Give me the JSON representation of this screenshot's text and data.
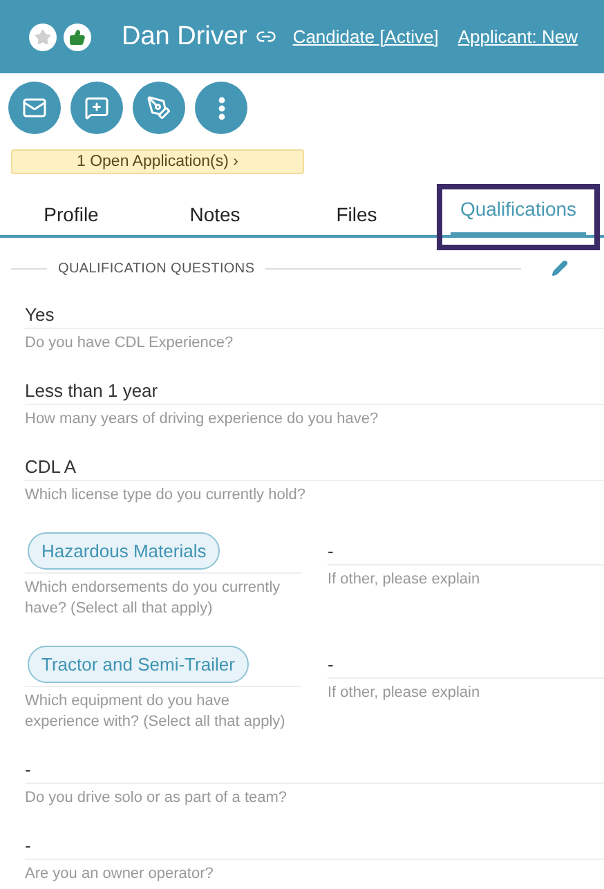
{
  "header": {
    "favorite": false,
    "liked": true,
    "name": "Dan Driver",
    "links": [
      "Candidate [Active]",
      "Applicant: New"
    ]
  },
  "banner": {
    "text": "1 Open Application(s)",
    "chevron": "›"
  },
  "tabs": [
    {
      "label": "Profile",
      "selected": false
    },
    {
      "label": "Notes",
      "selected": false
    },
    {
      "label": "Files",
      "selected": false
    },
    {
      "label": "Qualifications",
      "selected": true
    }
  ],
  "section": {
    "title": "QUALIFICATION QUESTIONS"
  },
  "questions": [
    {
      "kind": "text",
      "value": "Yes",
      "question": "Do you have CDL Experience?"
    },
    {
      "kind": "text",
      "value": "Less than 1 year",
      "question": "How many years of driving experience do you have?"
    },
    {
      "kind": "text",
      "value": "CDL A",
      "question": "Which license type do you currently hold?"
    },
    {
      "kind": "chips",
      "chips": [
        "Hazardous Materials"
      ],
      "question": "Which endorsements do you currently have? (Select all that apply)",
      "other_value": "-",
      "other_question": "If other, please explain"
    },
    {
      "kind": "chips",
      "chips": [
        "Tractor and Semi-Trailer"
      ],
      "question": "Which equipment do you have experience with? (Select all that apply)",
      "other_value": "-",
      "other_question": "If other, please explain"
    },
    {
      "kind": "text",
      "value": "-",
      "question": "Do you drive solo or as part of a team?"
    },
    {
      "kind": "text",
      "value": "-",
      "question": "Are you an owner operator?"
    }
  ]
}
